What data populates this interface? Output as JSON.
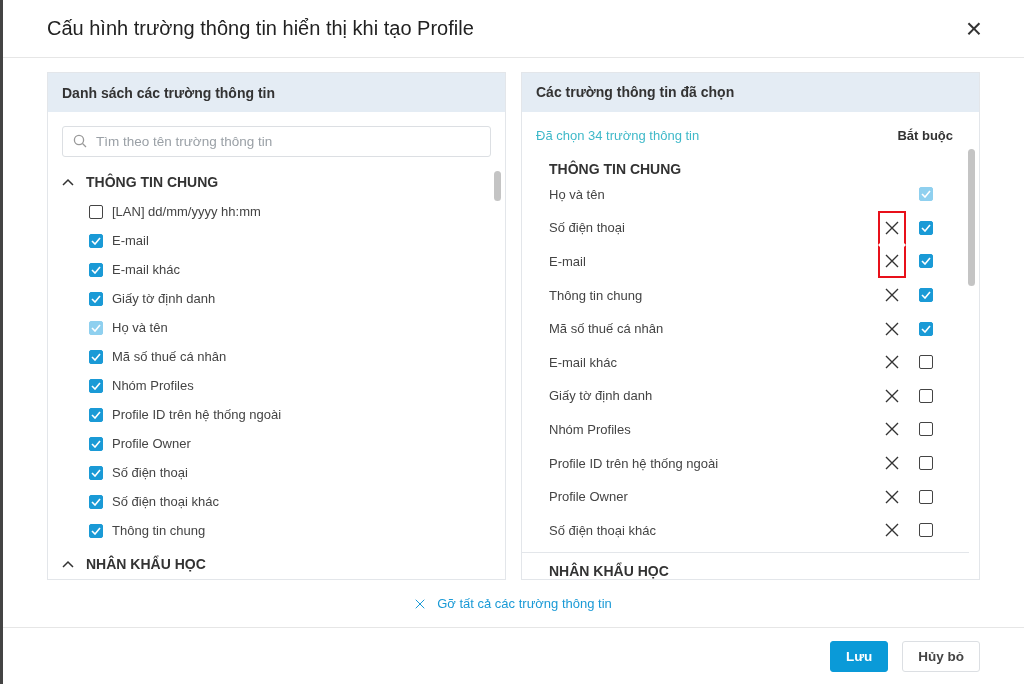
{
  "dialog": {
    "title": "Cấu hình trường thông tin hiển thị khi tạo Profile",
    "close": "×"
  },
  "available": {
    "title": "Danh sách các trường thông tin",
    "search": {
      "placeholder": "Tìm theo tên trường thông tin"
    },
    "groups": [
      {
        "name": "THÔNG TIN CHUNG",
        "expanded": true,
        "items": [
          {
            "label": "[LAN] dd/mm/yyyy hh:mm",
            "checked": false,
            "disabled": false
          },
          {
            "label": "E-mail",
            "checked": true,
            "disabled": false
          },
          {
            "label": "E-mail khác",
            "checked": true,
            "disabled": false
          },
          {
            "label": "Giấy tờ định danh",
            "checked": true,
            "disabled": false
          },
          {
            "label": "Họ và tên",
            "checked": true,
            "disabled": true
          },
          {
            "label": "Mã số thuế cá nhân",
            "checked": true,
            "disabled": false
          },
          {
            "label": "Nhóm Profiles",
            "checked": true,
            "disabled": false
          },
          {
            "label": "Profile ID trên hệ thống ngoài",
            "checked": true,
            "disabled": false
          },
          {
            "label": "Profile Owner",
            "checked": true,
            "disabled": false
          },
          {
            "label": "Số điện thoại",
            "checked": true,
            "disabled": false
          },
          {
            "label": "Số điện thoại khác",
            "checked": true,
            "disabled": false
          },
          {
            "label": "Thông tin chung",
            "checked": true,
            "disabled": false
          }
        ]
      },
      {
        "name": "NHÂN KHẨU HỌC",
        "expanded": true
      }
    ]
  },
  "selected": {
    "title": "Các trường thông tin đã chọn",
    "count": "Đã chọn 34 trường thông tin",
    "required_header": "Bắt buộc",
    "groups": [
      {
        "name": "THÔNG TIN CHUNG",
        "rows": [
          {
            "label": "Họ và tên",
            "removable": false,
            "required": true,
            "disabled": true,
            "highlighted": false
          },
          {
            "label": "Số điện thoại",
            "removable": true,
            "required": true,
            "disabled": false,
            "highlighted": true
          },
          {
            "label": "E-mail",
            "removable": true,
            "required": true,
            "disabled": false,
            "highlighted": true
          },
          {
            "label": "Thông tin chung",
            "removable": true,
            "required": true,
            "disabled": false,
            "highlighted": false
          },
          {
            "label": "Mã số thuế cá nhân",
            "removable": true,
            "required": true,
            "disabled": false,
            "highlighted": false
          },
          {
            "label": "E-mail khác",
            "removable": true,
            "required": false,
            "disabled": false,
            "highlighted": false
          },
          {
            "label": "Giấy tờ định danh",
            "removable": true,
            "required": false,
            "disabled": false,
            "highlighted": false
          },
          {
            "label": "Nhóm Profiles",
            "removable": true,
            "required": false,
            "disabled": false,
            "highlighted": false
          },
          {
            "label": "Profile ID trên hệ thống ngoài",
            "removable": true,
            "required": false,
            "disabled": false,
            "highlighted": false
          },
          {
            "label": "Profile Owner",
            "removable": true,
            "required": false,
            "disabled": false,
            "highlighted": false
          },
          {
            "label": "Số điện thoại khác",
            "removable": true,
            "required": false,
            "disabled": false,
            "highlighted": false
          }
        ]
      },
      {
        "name": "NHÂN KHẨU HỌC"
      }
    ]
  },
  "remove_all": "Gỡ tất cả các trường thông tin",
  "buttons": [
    {
      "label": "Lưu",
      "kind": "primary"
    },
    {
      "label": "Hủy bỏ",
      "kind": "secondary"
    }
  ]
}
